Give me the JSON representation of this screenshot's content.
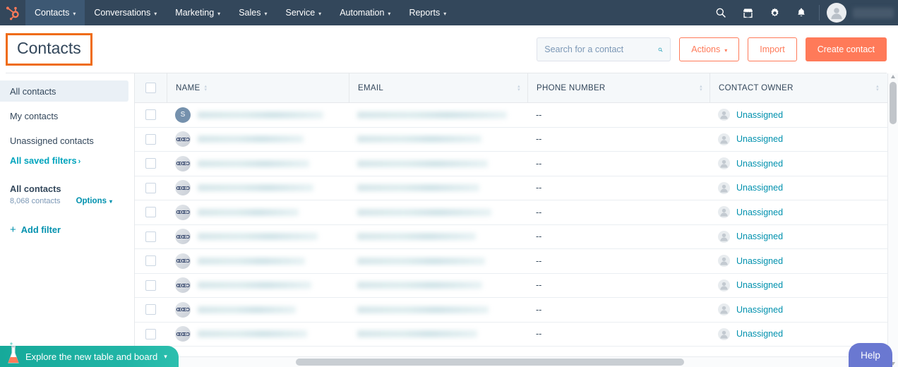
{
  "topnav": {
    "logo": "hubspot-sprocket-logo",
    "items": [
      {
        "label": "Contacts",
        "caret": "▾",
        "active": true
      },
      {
        "label": "Conversations",
        "caret": "▾",
        "active": false
      },
      {
        "label": "Marketing",
        "caret": "▾",
        "active": false
      },
      {
        "label": "Sales",
        "caret": "▾",
        "active": false
      },
      {
        "label": "Service",
        "caret": "▾",
        "active": false
      },
      {
        "label": "Automation",
        "caret": "▾",
        "active": false
      },
      {
        "label": "Reports",
        "caret": "▾",
        "active": false
      }
    ],
    "icons": [
      "search-icon",
      "marketplace-icon",
      "settings-gear-icon",
      "notifications-bell-icon"
    ],
    "avatar": "user-avatar"
  },
  "header": {
    "title": "Contacts",
    "highlight_color": "#ef6c15",
    "search": {
      "placeholder": "Search for a contact",
      "value": "",
      "icon": "search-icon"
    },
    "actions_button": {
      "label": "Actions",
      "caret": "▾"
    },
    "import_button": {
      "label": "Import"
    },
    "create_button": {
      "label": "Create contact"
    },
    "accent_color": "#ff7a59"
  },
  "sidebar": {
    "items": [
      {
        "label": "All contacts",
        "selected": true
      },
      {
        "label": "My contacts",
        "selected": false
      },
      {
        "label": "Unassigned contacts",
        "selected": false
      }
    ],
    "saved_filters_link": {
      "label": "All saved filters",
      "chevron": "›"
    },
    "current_view": {
      "title": "All contacts",
      "count": "8,068 contacts",
      "options_label": "Options",
      "options_caret": "▾"
    },
    "add_filter": {
      "plus": "+",
      "label": "Add filter"
    },
    "link_color": "#00a4bd"
  },
  "table": {
    "select_all_checkbox": false,
    "columns": [
      {
        "key": "name",
        "label": "NAME",
        "sortable": true
      },
      {
        "key": "email",
        "label": "EMAIL",
        "sortable": true
      },
      {
        "key": "phone",
        "label": "PHONE NUMBER",
        "sortable": true
      },
      {
        "key": "owner",
        "label": "CONTACT OWNER",
        "sortable": true
      }
    ],
    "sort_up": "▴",
    "sort_down": "▾",
    "rows": [
      {
        "avatar_type": "letter",
        "avatar_text": "S",
        "name": "",
        "name_redacted": true,
        "email": "",
        "email_redacted": true,
        "phone": "--",
        "owner": "Unassigned",
        "name_blur_width": 178,
        "email_blur_width": 212
      },
      {
        "avatar_type": "logo",
        "avatar_text": "ŒŒƆ",
        "name": "",
        "name_redacted": true,
        "email": "",
        "email_redacted": true,
        "phone": "--",
        "owner": "Unassigned",
        "name_blur_width": 150,
        "email_blur_width": 176
      },
      {
        "avatar_type": "logo",
        "avatar_text": "ŒŒƆ",
        "name": "",
        "name_redacted": true,
        "email": "",
        "email_redacted": true,
        "phone": "--",
        "owner": "Unassigned",
        "name_blur_width": 158,
        "email_blur_width": 185
      },
      {
        "avatar_type": "logo",
        "avatar_text": "ŒŒƆ",
        "name": "",
        "name_redacted": true,
        "email": "",
        "email_redacted": true,
        "phone": "--",
        "owner": "Unassigned",
        "name_blur_width": 164,
        "email_blur_width": 173
      },
      {
        "avatar_type": "logo",
        "avatar_text": "ŒŒƆ",
        "name": "",
        "name_redacted": true,
        "email": "",
        "email_redacted": true,
        "phone": "--",
        "owner": "Unassigned",
        "name_blur_width": 143,
        "email_blur_width": 190
      },
      {
        "avatar_type": "logo",
        "avatar_text": "ŒŒƆ",
        "name": "",
        "name_redacted": true,
        "email": "",
        "email_redacted": true,
        "phone": "--",
        "owner": "Unassigned",
        "name_blur_width": 170,
        "email_blur_width": 168
      },
      {
        "avatar_type": "logo",
        "avatar_text": "ŒŒƆ",
        "name": "",
        "name_redacted": true,
        "email": "",
        "email_redacted": true,
        "phone": "--",
        "owner": "Unassigned",
        "name_blur_width": 152,
        "email_blur_width": 181
      },
      {
        "avatar_type": "logo",
        "avatar_text": "ŒŒƆ",
        "name": "",
        "name_redacted": true,
        "email": "",
        "email_redacted": true,
        "phone": "--",
        "owner": "Unassigned",
        "name_blur_width": 161,
        "email_blur_width": 177
      },
      {
        "avatar_type": "logo",
        "avatar_text": "ŒŒƆ",
        "name": "",
        "name_redacted": true,
        "email": "",
        "email_redacted": true,
        "phone": "--",
        "owner": "Unassigned",
        "name_blur_width": 139,
        "email_blur_width": 186
      },
      {
        "avatar_type": "logo",
        "avatar_text": "ŒŒƆ",
        "name": "",
        "name_redacted": true,
        "email": "",
        "email_redacted": true,
        "phone": "--",
        "owner": "Unassigned",
        "name_blur_width": 155,
        "email_blur_width": 170
      }
    ],
    "owner_link_color": "#0091ae"
  },
  "footer": {
    "explore_banner": {
      "label": "Explore the new table and board",
      "caret": "▾",
      "icon": "flask-icon",
      "color": "#19ada0"
    },
    "help_button": {
      "label": "Help",
      "color": "#6a78d1"
    }
  }
}
